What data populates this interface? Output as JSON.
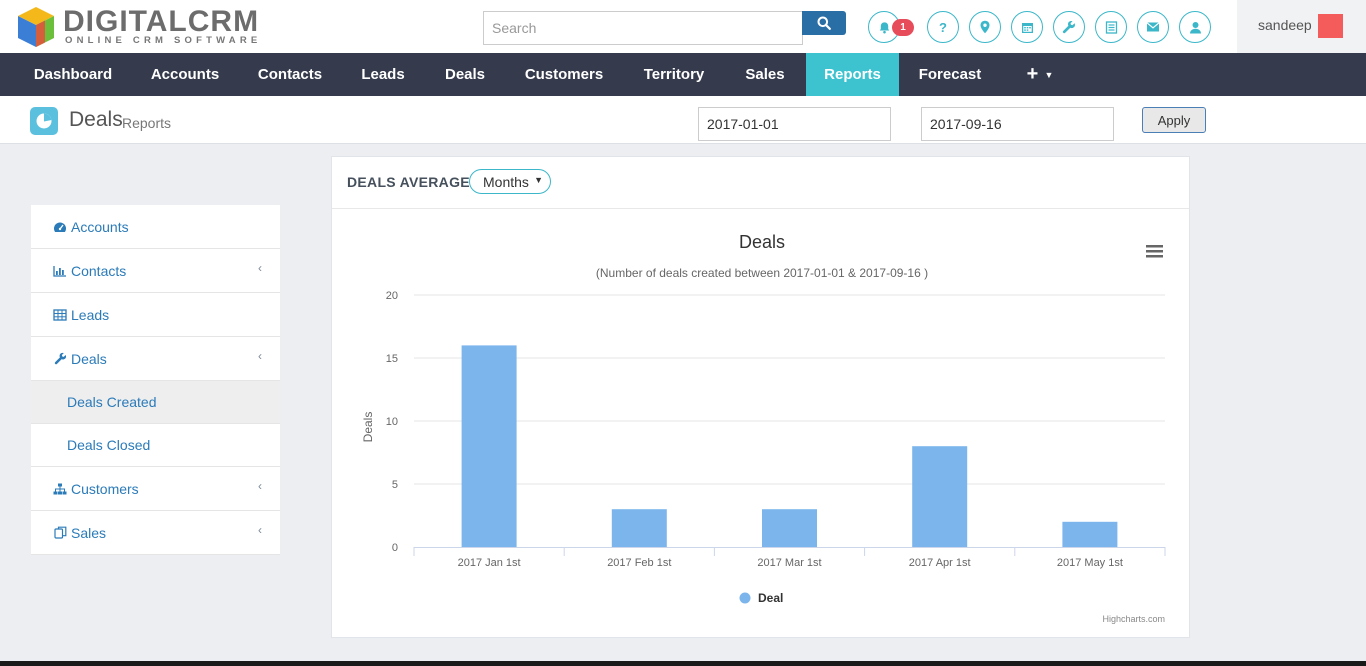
{
  "header": {
    "logo_title": "DIGITALCRM",
    "logo_subtitle": "ONLINE CRM SOFTWARE",
    "search_placeholder": "Search",
    "notification_count": "1",
    "user_name": "sandeep",
    "icons": [
      "bell-icon",
      "question-icon",
      "map-marker-icon",
      "calendar-icon",
      "wrench-icon",
      "list-icon",
      "envelope-icon",
      "user-icon"
    ]
  },
  "nav": {
    "items": [
      "Dashboard",
      "Accounts",
      "Contacts",
      "Leads",
      "Deals",
      "Customers",
      "Territory",
      "Sales",
      "Reports",
      "Forecast"
    ],
    "active": "Reports",
    "more_label": "+"
  },
  "page": {
    "title": "Deals",
    "subtitle": "Reports",
    "start_date": "2017-01-01",
    "end_date": "2017-09-16",
    "apply_label": "Apply"
  },
  "sidebar": {
    "items": [
      {
        "label": "Accounts"
      },
      {
        "label": "Contacts"
      },
      {
        "label": "Leads"
      },
      {
        "label": "Deals"
      },
      {
        "label": "Deals Created"
      },
      {
        "label": "Deals Closed"
      },
      {
        "label": "Customers"
      },
      {
        "label": "Sales"
      }
    ]
  },
  "panel": {
    "title": "DEALS AVERAGE",
    "period_select": "Months"
  },
  "chart_data": {
    "type": "bar",
    "title": "Deals",
    "subtitle": "(Number of deals created between 2017-01-01 & 2017-09-16 )",
    "categories": [
      "2017 Jan 1st",
      "2017 Feb 1st",
      "2017 Mar 1st",
      "2017 Apr 1st",
      "2017 May 1st"
    ],
    "series": [
      {
        "name": "Deal",
        "values": [
          16,
          3,
          3,
          8,
          2
        ],
        "color": "#7cb5ec"
      }
    ],
    "ylabel": "Deals",
    "xlabel": "",
    "ylim": [
      0,
      20
    ],
    "yticks": [
      0,
      5,
      10,
      15,
      20
    ],
    "grid": true,
    "legend": "bottom-center",
    "credits": "Highcharts.com"
  },
  "colors": {
    "nav_bg": "#353b4d",
    "nav_active": "#3cc3cf",
    "accent": "#3bb7c9",
    "link": "#2b7bb9",
    "badge": "#e74c5b"
  }
}
